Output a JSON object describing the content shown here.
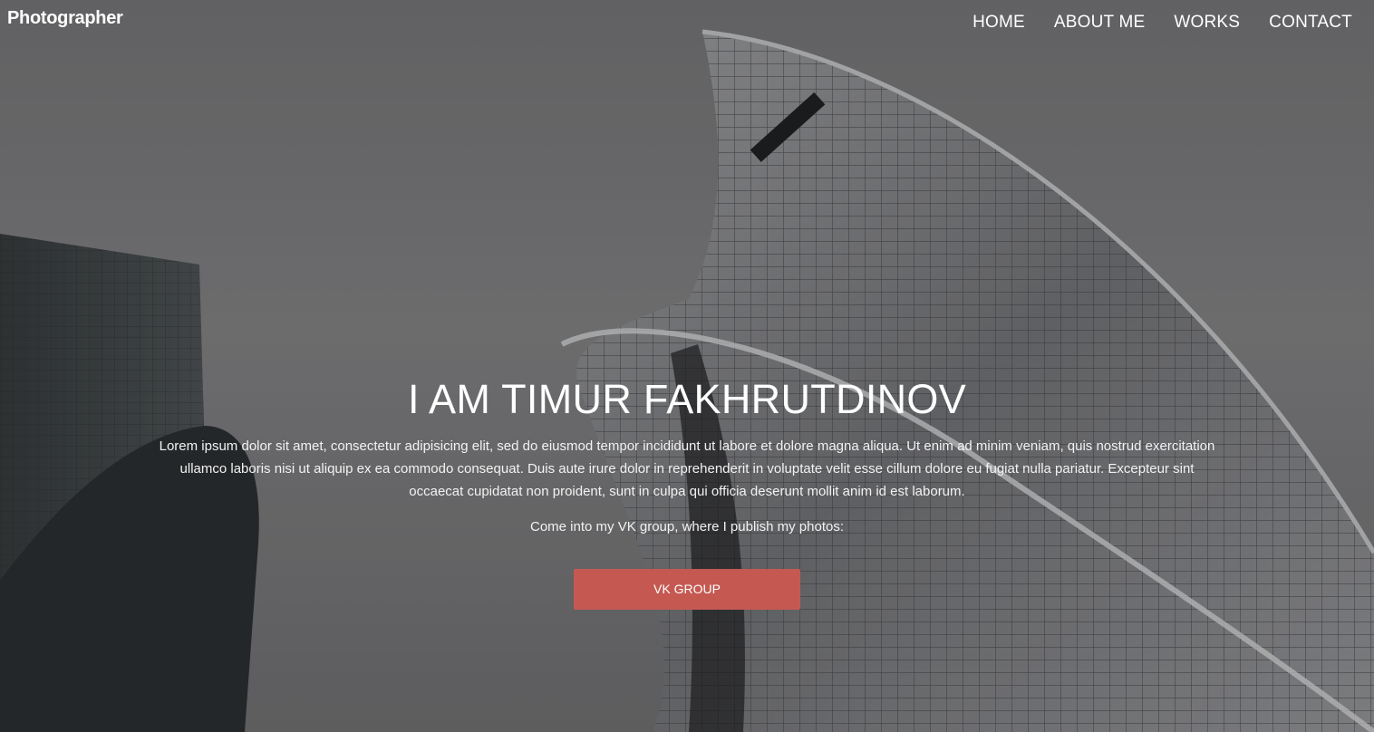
{
  "header": {
    "logo": "Photographer",
    "nav": [
      {
        "label": "HOME"
      },
      {
        "label": "ABOUT ME"
      },
      {
        "label": "WORKS"
      },
      {
        "label": "CONTACT"
      }
    ]
  },
  "hero": {
    "title": "I AM TIMUR FAKHRUTDINOV",
    "description": "Lorem ipsum dolor sit amet, consectetur adipisicing elit, sed do eiusmod tempor incididunt ut labore et dolore magna aliqua. Ut enim ad minim veniam, quis nostrud exercitation ullamco laboris nisi ut aliquip ex ea commodo consequat. Duis aute irure dolor in reprehenderit in voluptate velit esse cillum dolore eu fugiat nulla pariatur. Excepteur sint occaecat cupidatat non proident, sunt in culpa qui officia deserunt mollit anim id est laborum.",
    "note": "Come into my VK group, where I publish my photos:",
    "button_label": "VK GROUP"
  },
  "colors": {
    "accent": "#c55952",
    "overlay": "#6f6f71"
  }
}
